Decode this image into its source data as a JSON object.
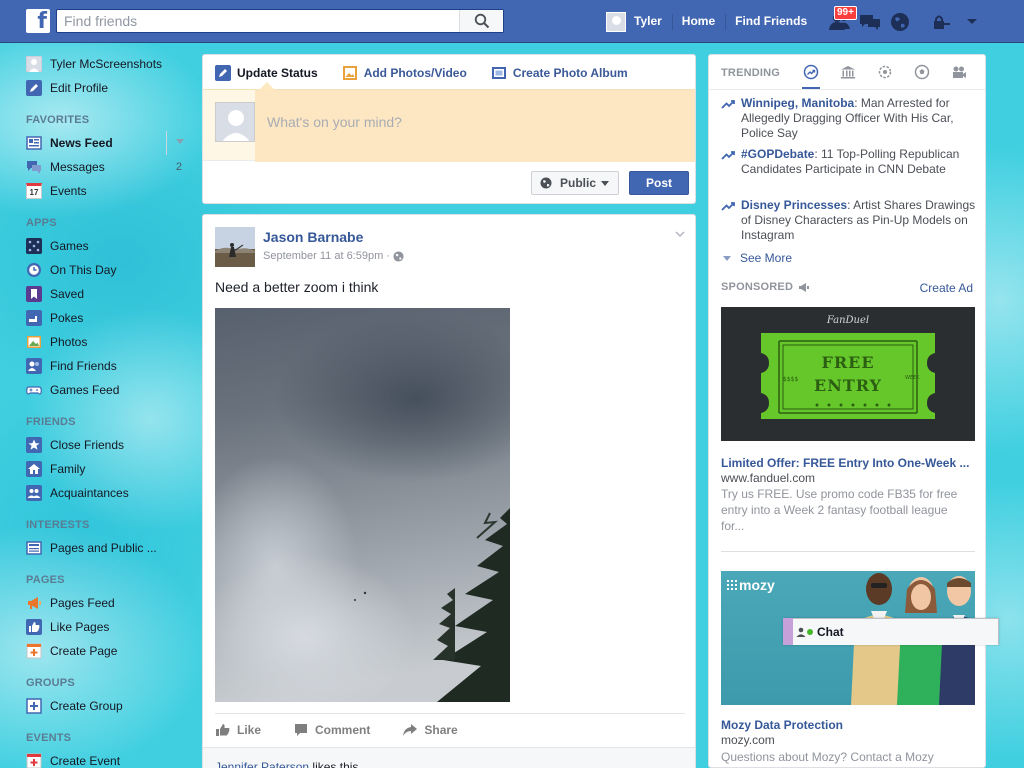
{
  "topbar": {
    "logo": "f",
    "search_placeholder": "Find friends",
    "user_name": "Tyler",
    "home_label": "Home",
    "find_friends_label": "Find Friends",
    "friend_requests_badge": "99+"
  },
  "sidebar": {
    "profile_name": "Tyler McScreenshots",
    "edit_profile": "Edit Profile",
    "sections": {
      "favorites": "FAVORITES",
      "apps": "APPS",
      "friends": "FRIENDS",
      "interests": "INTERESTS",
      "pages": "PAGES",
      "groups": "GROUPS",
      "events": "EVENTS"
    },
    "favorites": [
      {
        "label": "News Feed",
        "icon": "news-feed-icon"
      },
      {
        "label": "Messages",
        "icon": "messages-icon",
        "count": "2"
      },
      {
        "label": "Events",
        "icon": "calendar-icon",
        "icon_text": "17"
      }
    ],
    "apps": [
      {
        "label": "Games",
        "icon": "games-icon"
      },
      {
        "label": "On This Day",
        "icon": "clock-icon"
      },
      {
        "label": "Saved",
        "icon": "bookmark-icon"
      },
      {
        "label": "Pokes",
        "icon": "poke-icon"
      },
      {
        "label": "Photos",
        "icon": "photos-icon"
      },
      {
        "label": "Find Friends",
        "icon": "find-friends-icon"
      },
      {
        "label": "Games Feed",
        "icon": "gamepad-icon"
      }
    ],
    "friends": [
      {
        "label": "Close Friends",
        "icon": "star-icon"
      },
      {
        "label": "Family",
        "icon": "house-icon"
      },
      {
        "label": "Acquaintances",
        "icon": "people-icon"
      }
    ],
    "interests": [
      {
        "label": "Pages and Public ...",
        "icon": "newspaper-icon"
      }
    ],
    "pages": [
      {
        "label": "Pages Feed",
        "icon": "megaphone-icon"
      },
      {
        "label": "Like Pages",
        "icon": "thumbs-up-icon"
      },
      {
        "label": "Create Page",
        "icon": "plus-icon"
      }
    ],
    "groups": [
      {
        "label": "Create Group",
        "icon": "plus-square-icon"
      }
    ],
    "events": [
      {
        "label": "Create Event",
        "icon": "add-event-icon"
      }
    ]
  },
  "composer": {
    "tabs": [
      "Update Status",
      "Add Photos/Video",
      "Create Photo Album"
    ],
    "placeholder": "What's on your mind?",
    "privacy_label": "Public",
    "post_button": "Post"
  },
  "post": {
    "author": "Jason Barnabe",
    "timestamp": "September 11 at 6:59pm ·",
    "text": "Need a better zoom i think",
    "actions": [
      "Like",
      "Comment",
      "Share"
    ],
    "liker_name": "Jennifer Paterson",
    "likes_suffix": " likes this."
  },
  "trending": {
    "title": "TRENDING",
    "items": [
      {
        "topic": "Winnipeg, Manitoba",
        "desc": ": Man Arrested for Allegedly Dragging Officer With His Car, Police Say"
      },
      {
        "topic": "#GOPDebate",
        "desc": ": 11 Top-Polling Republican Candidates Participate in CNN Debate"
      },
      {
        "topic": "Disney Princesses",
        "desc": ": Artist Shares Drawings of Disney Characters as Pin-Up Models on Instagram"
      }
    ],
    "see_more": "See More"
  },
  "sponsored": {
    "title": "SPONSORED",
    "create_ad": "Create Ad",
    "ads": [
      {
        "brand_logo": "FanDuel",
        "ticket_text": [
          "FREE",
          "ENTRY"
        ],
        "title": "Limited Offer: FREE Entry Into One-Week ...",
        "domain": "www.fanduel.com",
        "desc": "Try us FREE. Use promo code FB35 for free entry into a Week 2 fantasy football league for..."
      },
      {
        "brand_logo": "mozy",
        "title": "Mozy Data Protection",
        "domain": "mozy.com",
        "desc": "Questions about Mozy? Contact a Mozy"
      }
    ]
  },
  "chat": {
    "label": "Chat"
  },
  "colors": {
    "brand_blue": "#4267b2",
    "link_blue": "#365899",
    "badge_red": "#fa3e3e",
    "ticket_green": "#65c72a"
  }
}
